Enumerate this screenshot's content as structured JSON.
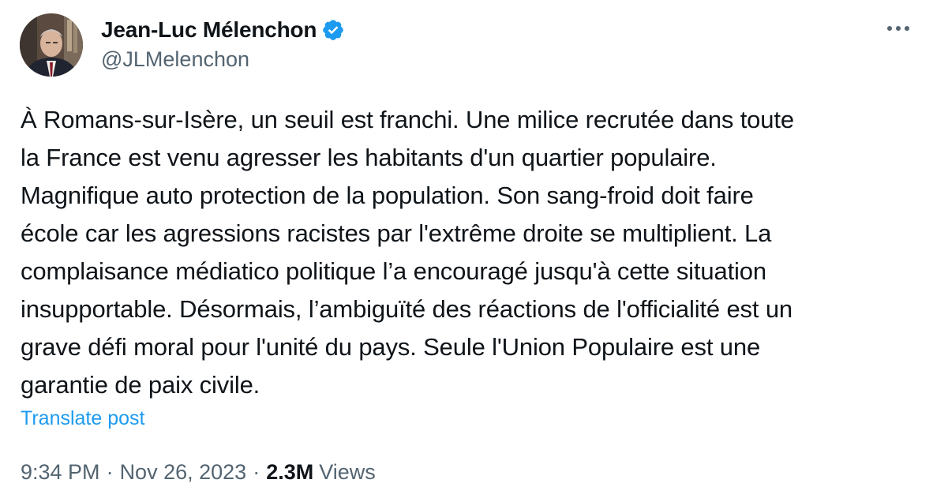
{
  "author": {
    "display_name": "Jean-Luc Mélenchon",
    "handle": "@JLMelenchon",
    "verified": true,
    "verified_color": "#1d9bf0"
  },
  "post": {
    "text_lines": [
      "À Romans-sur-Isère, un seuil est franchi. Une milice recrutée dans toute",
      "la France est venu agresser les habitants d'un quartier populaire.",
      "Magnifique auto protection de la population. Son sang-froid doit faire",
      "école car les agressions racistes par l'extrême droite se multiplient. La",
      "complaisance médiatico politique l’a encouragé jusqu'à cette situation",
      "insupportable. Désormais, l’ambiguïté des réactions de l'officialité est un",
      "grave défi moral pour l'unité du pays. Seule l'Union Populaire est une",
      "garantie de paix civile."
    ],
    "translate_label": "Translate post",
    "time": "9:34 PM",
    "separator": "·",
    "date": "Nov 26, 2023",
    "views_count": "2.3M",
    "views_label": "Views"
  },
  "icons": {
    "more": "more-options-icon",
    "verified": "verified-badge-icon"
  },
  "colors": {
    "text_primary": "#0f1419",
    "text_secondary": "#536471",
    "accent": "#1d9bf0"
  }
}
